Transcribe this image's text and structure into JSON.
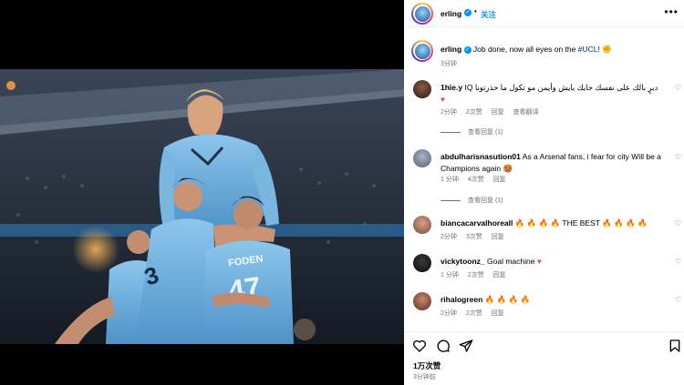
{
  "post": {
    "username": "erling",
    "follow_label": "关注",
    "more_label": "•••",
    "caption": {
      "username": "erling",
      "text_main": "Job done, now all eyes on the ",
      "hashtag": "#UCL",
      "text_end": "! ✊",
      "time": "3分钟"
    }
  },
  "photo": {
    "jersey_numbers": [
      "3",
      "47"
    ],
    "jersey_name": "FODEN"
  },
  "comments": [
    {
      "username": "1hie.y",
      "text": "ديرٍ بالك على نفسك جايك بايش وأيمن مو تكول ما حذرتونا IQ",
      "emoji": "♥",
      "time": "2分钟",
      "likes": "2次赞",
      "reply": "回复",
      "translate": "查看翻译",
      "view_replies": "查看回复 (1)"
    },
    {
      "username": "abdulharisnasution01",
      "text": "As a Arsenal fans, i fear for city Will be a Champions again",
      "emoji": "🥵",
      "time": "1 分钟",
      "likes": "4次赞",
      "reply": "回复",
      "view_replies": "查看回复 (1)"
    },
    {
      "username": "biancacarvalhoreall",
      "emoji_before": "🔥 🔥 🔥 🔥",
      "text": "THE BEST",
      "emoji": "🔥 🔥 🔥 🔥",
      "time": "2分钟",
      "likes": "3次赞",
      "reply": "回复"
    },
    {
      "username": "vickytoonz_",
      "text": "Goal machine",
      "emoji": "♥",
      "time": "1 分钟",
      "likes": "2次赞",
      "reply": "回复"
    },
    {
      "username": "rihalogreen",
      "text": "",
      "emoji": "🔥 🔥 🔥 🔥",
      "time": "2分钟",
      "likes": "2次赞",
      "reply": "回复"
    }
  ],
  "footer": {
    "likes": "1万次赞",
    "time_ago": "3分钟前"
  },
  "icons": {
    "like": "heart-icon",
    "comment": "comment-icon",
    "share": "send-icon",
    "save": "bookmark-icon"
  },
  "colors": {
    "link_blue": "#0095f6",
    "hashtag": "#00376b",
    "muted": "#737373",
    "city_blue": "#6cabdd"
  }
}
